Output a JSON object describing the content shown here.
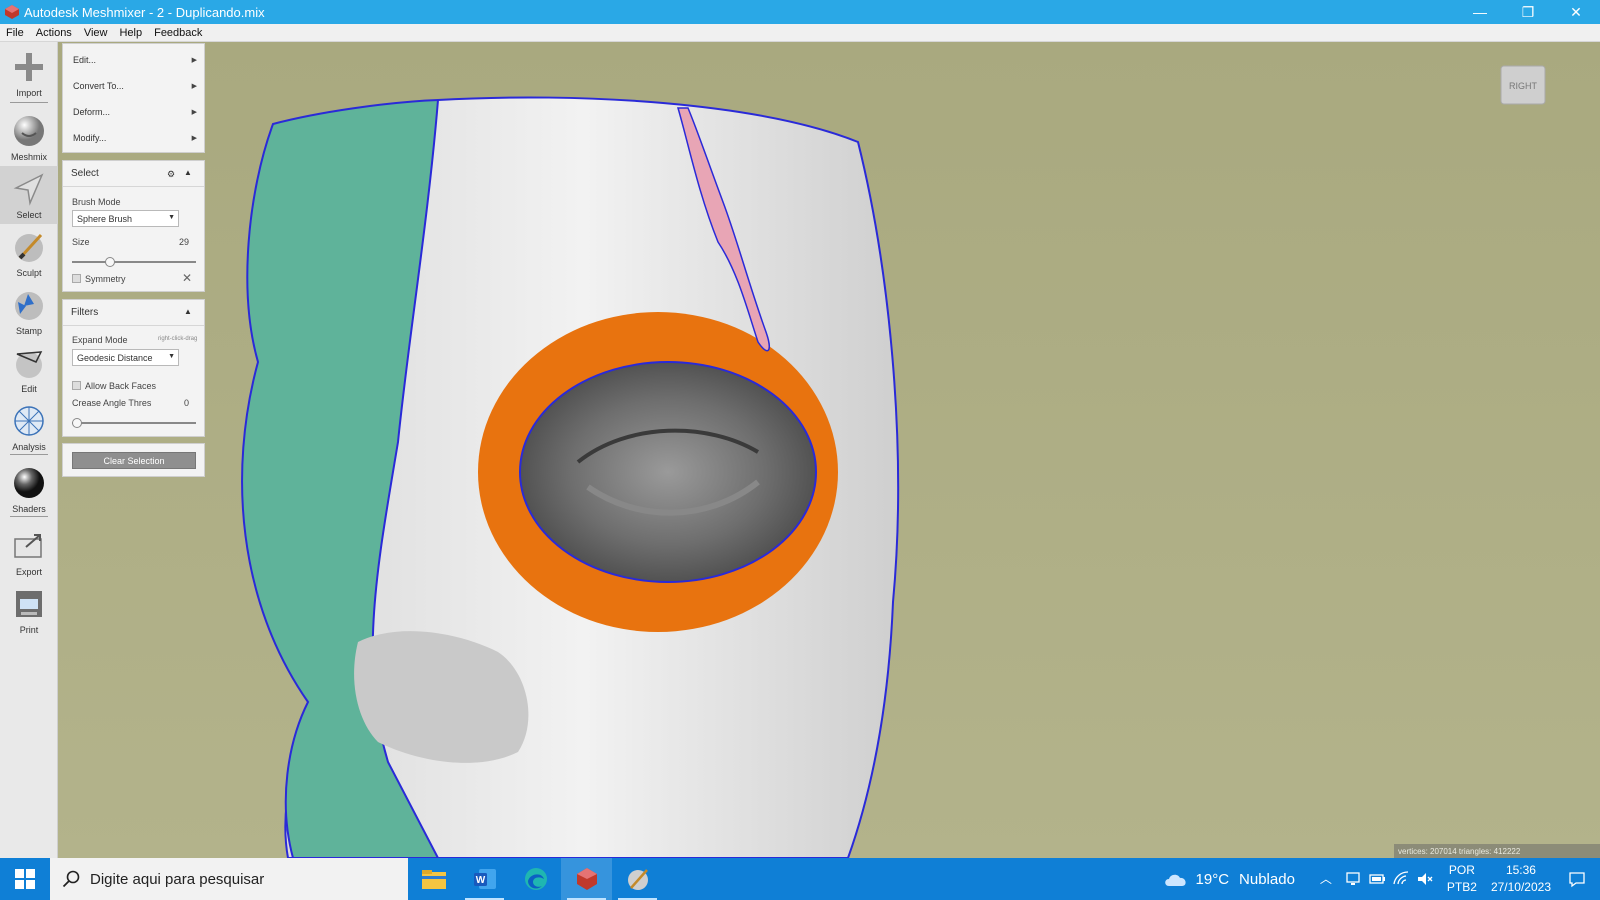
{
  "window": {
    "title": "Autodesk Meshmixer - 2 - Duplicando.mix",
    "minimize": "—",
    "restore": "❐",
    "close": "✕"
  },
  "menubar": [
    "File",
    "Actions",
    "View",
    "Help",
    "Feedback"
  ],
  "toolbar": [
    {
      "label": "Import",
      "icon": "plus-icon"
    },
    {
      "label": "Meshmix",
      "icon": "meshmix-sphere-icon"
    },
    {
      "label": "Select",
      "icon": "select-arrow-icon",
      "active": true
    },
    {
      "label": "Sculpt",
      "icon": "sculpt-brush-icon"
    },
    {
      "label": "Stamp",
      "icon": "stamp-icon"
    },
    {
      "label": "Edit",
      "icon": "edit-icon"
    },
    {
      "label": "Analysis",
      "icon": "analysis-icon"
    },
    {
      "label": "Shaders",
      "icon": "shaders-sphere-icon"
    },
    {
      "label": "Export",
      "icon": "export-icon"
    },
    {
      "label": "Print",
      "icon": "printer-icon"
    }
  ],
  "actions_menu": [
    "Edit...",
    "Convert To...",
    "Deform...",
    "Modify..."
  ],
  "select_panel": {
    "title": "Select",
    "brush_mode_label": "Brush Mode",
    "brush_mode_value": "Sphere Brush",
    "size_label": "Size",
    "size_value": "29",
    "size_fraction": 0.29,
    "symmetry_label": "Symmetry"
  },
  "filters_panel": {
    "title": "Filters",
    "expand_mode_label": "Expand Mode",
    "expand_mode_hint": "right-click-drag",
    "expand_mode_value": "Geodesic Distance",
    "allow_back_faces_label": "Allow Back Faces",
    "crease_angle_label": "Crease Angle Thres",
    "crease_angle_value": "0",
    "crease_fraction": 0
  },
  "clear_selection_label": "Clear Selection",
  "viewcube_label": "RIGHT",
  "status": "vertices: 207014  triangles: 412222",
  "taskbar": {
    "search_placeholder": "Digite aqui para pesquisar",
    "apps": [
      "file-explorer-icon",
      "word-icon",
      "edge-icon",
      "meshmixer-icon",
      "sculpt-app-icon"
    ],
    "weather_temp": "19°C",
    "weather_desc": "Nublado",
    "lang_line1": "POR",
    "lang_line2": "PTB2",
    "time": "15:36",
    "date": "27/10/2023"
  },
  "colors": {
    "titlebar": "#2aa8e6",
    "viewport_bg": "#a9a97f",
    "mesh_white": "#e8e8e8",
    "mesh_teal": "#5fb39a",
    "selection_orange": "#e8730f",
    "outline_blue": "#2a2ad8",
    "taskbar": "#0f7fd6"
  }
}
